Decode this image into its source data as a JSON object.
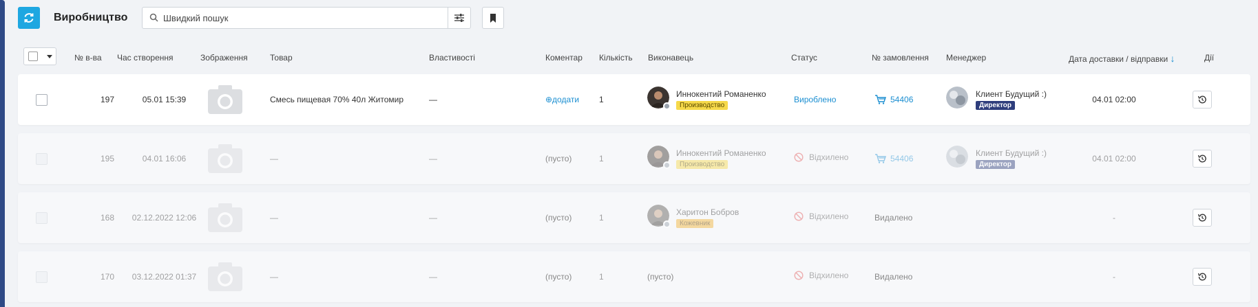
{
  "header": {
    "title": "Виробництво",
    "search_placeholder": "Швидкий пошук"
  },
  "columns": {
    "num": "№ в-ва",
    "created": "Час створення",
    "image": "Зображення",
    "product": "Товар",
    "properties": "Властивості",
    "comment": "Коментар",
    "quantity": "Кількість",
    "executor": "Виконавець",
    "status": "Статус",
    "order": "№ замовлення",
    "manager": "Менеджер",
    "delivery": "Дата доставки / відправки",
    "actions": "Дії"
  },
  "sort_indicator": "↓",
  "rows": [
    {
      "num": "197",
      "created": "05.01 15:39",
      "product": "Смесь пищевая 70% 40л Житомир",
      "properties": "—",
      "comment": "⊕додати",
      "quantity": "1",
      "executor_name": "Иннокентий Романенко",
      "executor_role": "Производство",
      "status": "Вироблено",
      "order": "54406",
      "manager_name": "Клиент Будущий :)",
      "manager_role": "Директор",
      "delivery": "04.01 02:00"
    },
    {
      "num": "195",
      "created": "04.01 16:06",
      "product": "—",
      "properties": "—",
      "comment": "(пусто)",
      "quantity": "1",
      "executor_name": "Иннокентий Романенко",
      "executor_role": "Производство",
      "status": "Відхилено",
      "order": "54406",
      "manager_name": "Клиент Будущий :)",
      "manager_role": "Директор",
      "delivery": "04.01 02:00"
    },
    {
      "num": "168",
      "created": "02.12.2022 12:06",
      "product": "—",
      "properties": "—",
      "comment": "(пусто)",
      "quantity": "1",
      "executor_name": "Харитон Бобров",
      "executor_role": "Кожевник",
      "status": "Відхилено",
      "order": "Видалено",
      "delivery": "-"
    },
    {
      "num": "170",
      "created": "03.12.2022 01:37",
      "product": "—",
      "properties": "—",
      "comment": "(пусто)",
      "quantity": "1",
      "executor_empty": "(пусто)",
      "status": "Відхилено",
      "order": "Видалено",
      "delivery": "-"
    }
  ],
  "icons": {
    "refresh": "refresh-icon",
    "search": "search-icon",
    "filter": "sliders-icon",
    "bookmark": "bookmark-icon",
    "image_placeholder": "camera-icon",
    "cart": "cart-icon",
    "rejected": "ban-icon",
    "history": "history-icon"
  },
  "colors": {
    "accent": "#1ea7e1",
    "link": "#1a8ed1",
    "badge_production": "#f6d94a",
    "badge_tanner": "#f2b233",
    "badge_director": "#2e3d7c",
    "sidebar": "#2f4a86"
  }
}
